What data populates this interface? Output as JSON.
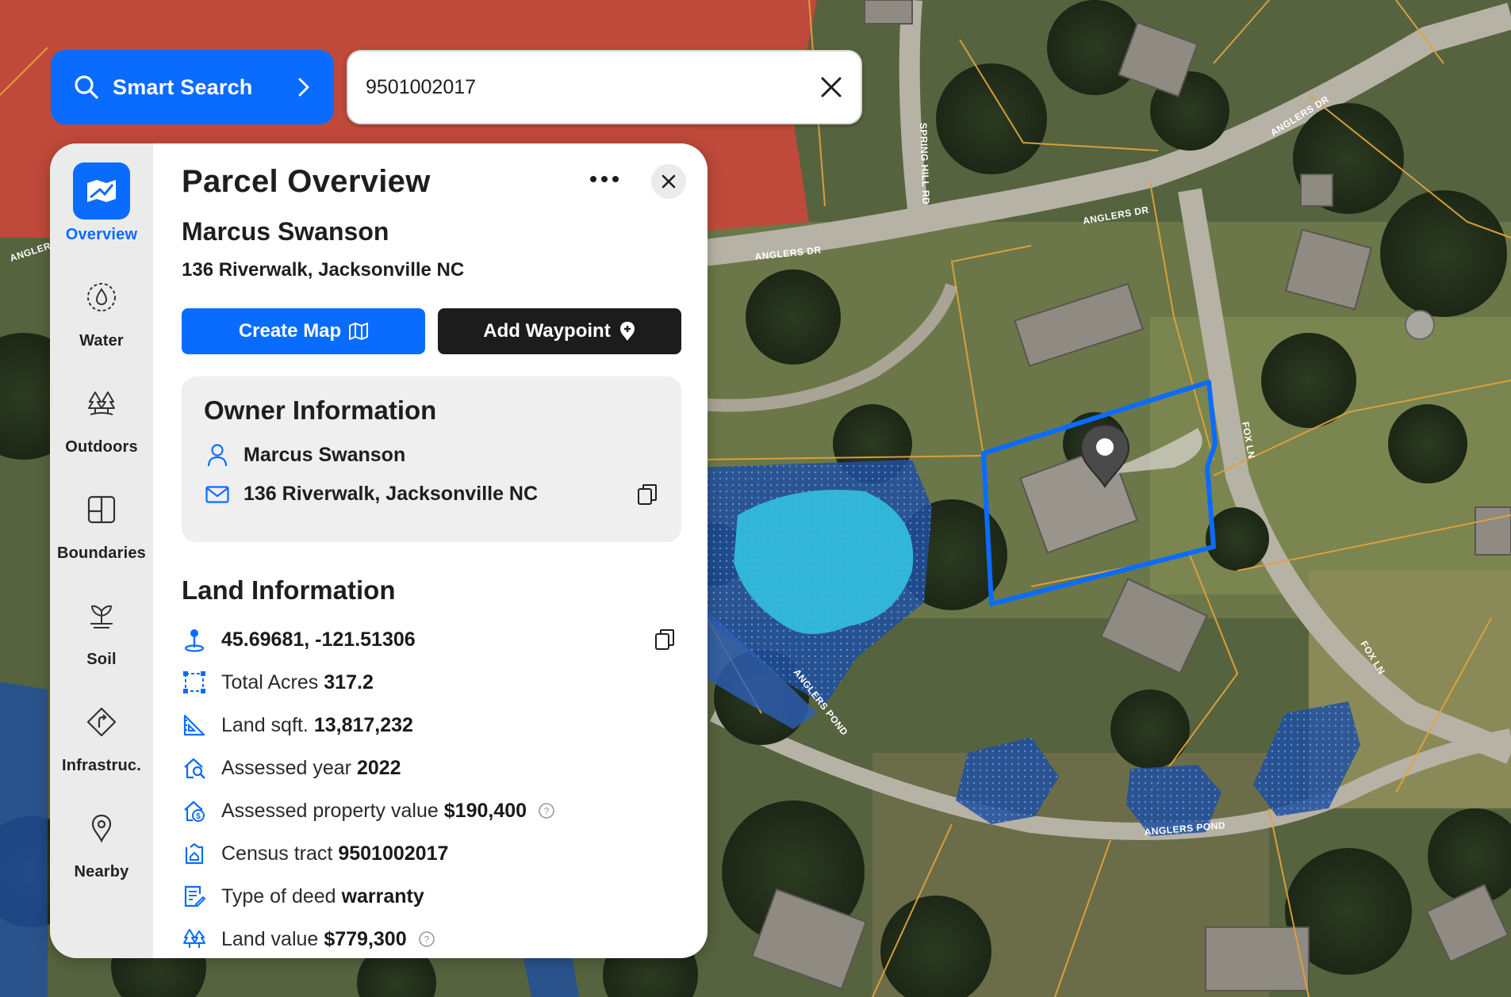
{
  "search": {
    "smart_search_label": "Smart Search",
    "query": "9501002017"
  },
  "map": {
    "street_labels": [
      "ANGLERS DR",
      "ANGLERS DR",
      "ANGLERS DR",
      "ANGLERS DR",
      "SPRING HILL RD",
      "FOX LN",
      "FOX LN",
      "ANGLERS POND",
      "ANGLERS POND"
    ],
    "parcel_color": "#0a6cff",
    "water_color": "#2fb6d8",
    "flood_color": "#1f4fa0",
    "restricted_color": "#c8473a",
    "lot_line_color": "#e0a23c"
  },
  "sidebar": {
    "items": [
      {
        "label": "Overview",
        "icon": "overview-map-icon",
        "active": true
      },
      {
        "label": "Water",
        "icon": "water-drop-icon",
        "active": false
      },
      {
        "label": "Outdoors",
        "icon": "trees-icon",
        "active": false
      },
      {
        "label": "Boundaries",
        "icon": "boundaries-grid-icon",
        "active": false
      },
      {
        "label": "Soil",
        "icon": "sprout-icon",
        "active": false
      },
      {
        "label": "Infrastruc.",
        "icon": "road-sign-icon",
        "active": false
      },
      {
        "label": "Nearby",
        "icon": "pin-icon",
        "active": false
      }
    ]
  },
  "panel": {
    "title": "Parcel Overview",
    "owner_name": "Marcus Swanson",
    "owner_address": "136 Riverwalk, Jacksonville NC",
    "create_map_label": "Create Map",
    "add_waypoint_label": "Add Waypoint",
    "owner_card": {
      "title": "Owner Information",
      "name": "Marcus Swanson",
      "address": "136 Riverwalk, Jacksonville NC"
    },
    "land": {
      "title": "Land Information",
      "coordinates": "45.69681, -121.51306",
      "total_acres_label": "Total Acres",
      "total_acres": "317.2",
      "land_sqft_label": "Land sqft.",
      "land_sqft": "13,817,232",
      "assessed_year_label": "Assessed year",
      "assessed_year": "2022",
      "assessed_value_label": "Assessed property value",
      "assessed_value": "$190,400",
      "census_tract_label": "Census tract",
      "census_tract": "9501002017",
      "deed_label": "Type of deed",
      "deed": "warranty",
      "land_value_label": "Land value",
      "land_value": "$779,300"
    }
  }
}
